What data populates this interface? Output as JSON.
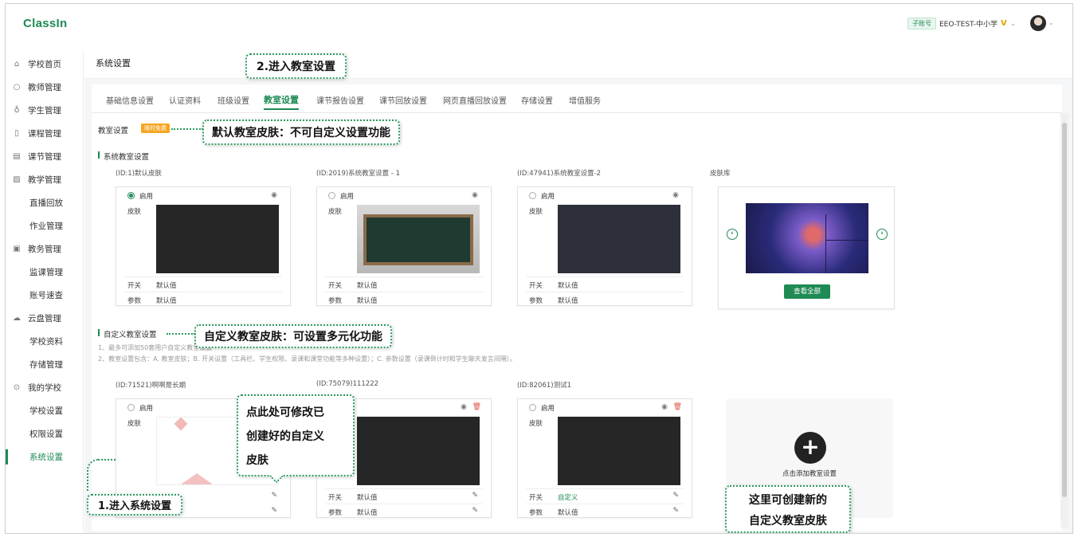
{
  "app": {
    "logo": "ClassIn"
  },
  "header": {
    "account_tag": "子账号",
    "account_name": "EEO-TEST-中小学",
    "vip_mark": "V",
    "chevron": "⌄"
  },
  "sidebar": {
    "items": [
      {
        "label": "学校首页",
        "icon": "home-icon"
      },
      {
        "label": "教师管理",
        "icon": "user-icon"
      },
      {
        "label": "学生管理",
        "icon": "users-icon"
      },
      {
        "label": "课程管理",
        "icon": "course-icon"
      },
      {
        "label": "课节管理",
        "icon": "lesson-icon"
      },
      {
        "label": "教学管理",
        "icon": "teach-icon"
      },
      {
        "label": "直播回放",
        "sub": true
      },
      {
        "label": "作业管理",
        "sub": true
      },
      {
        "label": "教务管理",
        "icon": "affairs-icon"
      },
      {
        "label": "监课管理",
        "sub": true
      },
      {
        "label": "账号速查",
        "sub": true
      },
      {
        "label": "云盘管理",
        "icon": "cloud-icon"
      },
      {
        "label": "学校资料",
        "sub": true
      },
      {
        "label": "存储管理",
        "sub": true
      },
      {
        "label": "我的学校",
        "icon": "school-icon"
      },
      {
        "label": "学校设置",
        "sub": true
      },
      {
        "label": "权限设置",
        "sub": true
      },
      {
        "label": "系统设置",
        "sub": true,
        "active": true
      }
    ]
  },
  "page": {
    "title": "系统设置"
  },
  "tabs": [
    "基础信息设置",
    "认证资料",
    "班级设置",
    "教室设置",
    "课节报告设置",
    "课节回放设置",
    "网页直播回放设置",
    "存储设置",
    "增值服务"
  ],
  "classroom": {
    "section_title": "教室设置",
    "free_badge": "限时免费",
    "system_group": "系统教室设置",
    "custom_group": "自定义教室设置",
    "note1": "1、最多可添加50套用户自定义教室设置",
    "note2": "2、教室设置包含：A. 教室皮肤；B. 开关设置（工具栏、学生权限、录课和课堂功能等多种设置）；C. 参数设置（录课倒计时和学生聊天发言间隔）。",
    "skin_library": "皮肤库",
    "view_all": "查看全部",
    "add_text": "点击添加教室设置",
    "enable_label": "启用",
    "skin_label": "皮肤",
    "switch_label": "开关",
    "param_label": "参数",
    "default_value": "默认值",
    "custom_value": "自定义",
    "system_cards": [
      {
        "id": "(ID:1)默认皮肤"
      },
      {
        "id": "(ID:2019)系统教室设置 - 1"
      },
      {
        "id": "(ID:47941)系统教室设置-2"
      }
    ],
    "custom_cards": [
      {
        "id": "(ID:71521)啊啊是长期"
      },
      {
        "id": "(ID:75079)111222"
      },
      {
        "id": "(ID:82061)测试1"
      }
    ]
  },
  "callouts": {
    "c1": "2.进入教室设置",
    "c2": "默认教室皮肤：不可自定义设置功能",
    "c3": "自定义教室皮肤：可设置多元化功能",
    "c4a": "点此处可修改已",
    "c4b": "创建好的自定义",
    "c4c": "皮肤",
    "c5": "1.进入系统设置",
    "c6a": "这里可创建新的",
    "c6b": "自定义教室皮肤"
  }
}
